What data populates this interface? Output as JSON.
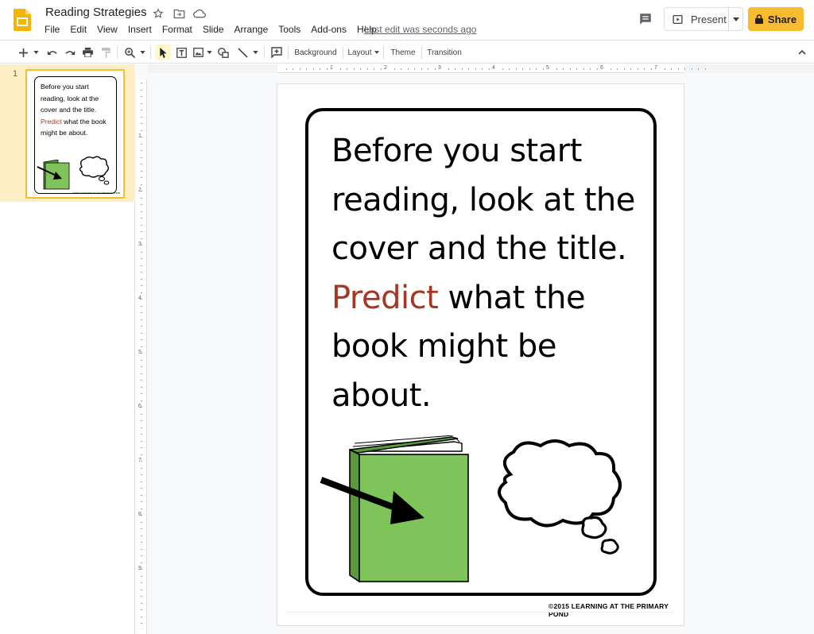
{
  "header": {
    "title": "Reading Strategies",
    "menu": [
      "File",
      "Edit",
      "View",
      "Insert",
      "Format",
      "Slide",
      "Arrange",
      "Tools",
      "Add-ons",
      "Help"
    ],
    "last_edit": "Last edit was seconds ago",
    "present_label": "Present",
    "share_label": "Share"
  },
  "toolbar": {
    "background_label": "Background",
    "layout_label": "Layout",
    "theme_label": "Theme",
    "transition_label": "Transition"
  },
  "filmstrip": {
    "slides": [
      {
        "number": "1",
        "text_before": "Before you start reading, look at the cover and the title. ",
        "text_highlight": "Predict",
        "text_after": " what the book might be about.",
        "footer": "©2015 LEARNING AT THE PRIMARY POND"
      }
    ]
  },
  "ruler": {
    "horizontal": [
      "1",
      "2",
      "3",
      "4",
      "5",
      "6",
      "7"
    ],
    "vertical": [
      "1",
      "2",
      "3",
      "4",
      "5",
      "6",
      "7",
      "8",
      "9"
    ]
  },
  "slide": {
    "text_before": "Before you start reading, look at the cover and the title. ",
    "text_highlight": "Predict",
    "text_after": " what the book might be about.",
    "credit": "©2015 LEARNING AT THE PRIMARY POND",
    "colors": {
      "highlight": "#a63624",
      "book_green": "#7fc45b",
      "book_dark": "#5a9a3c",
      "accent_yellow": "#f8bb30"
    }
  }
}
